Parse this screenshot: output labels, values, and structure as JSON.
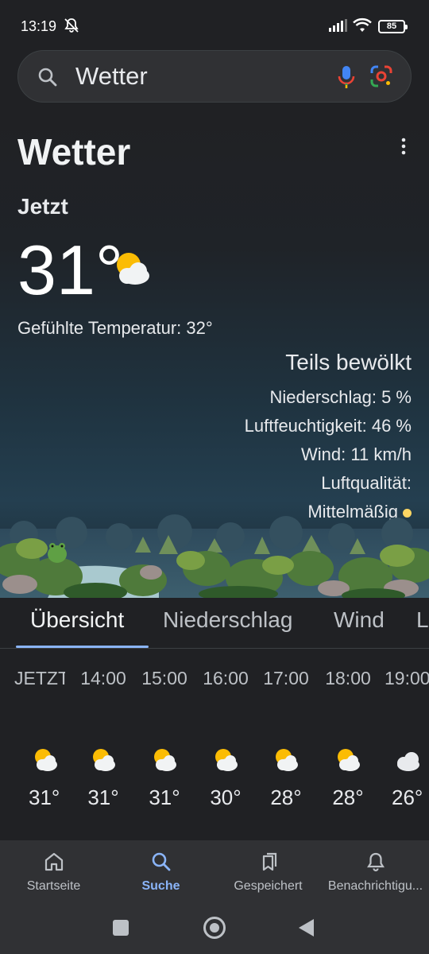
{
  "status": {
    "time": "13:19",
    "battery": "85"
  },
  "search": {
    "query": "Wetter"
  },
  "weather": {
    "title": "Wetter",
    "now_label": "Jetzt",
    "temperature": "31°",
    "feels_like": "Gefühlte Temperatur: 32°",
    "condition": "Teils bewölkt",
    "precipitation": "Niederschlag: 5 %",
    "humidity": "Luftfeuchtigkeit: 46 %",
    "wind": "Wind: 11 km/h",
    "air_quality_label": "Luftqualität:",
    "air_quality_value": "Mittelmäßig",
    "air_quality_color": "#fdd663"
  },
  "tabs": [
    {
      "label": "Übersicht",
      "active": true
    },
    {
      "label": "Niederschlag",
      "active": false
    },
    {
      "label": "Wind",
      "active": false
    },
    {
      "label": "L",
      "active": false
    }
  ],
  "hourly": [
    {
      "time": "JETZT",
      "icon": "partly-cloudy-icon",
      "temp": "31°"
    },
    {
      "time": "14:00",
      "icon": "partly-cloudy-icon",
      "temp": "31°"
    },
    {
      "time": "15:00",
      "icon": "partly-cloudy-icon",
      "temp": "31°"
    },
    {
      "time": "16:00",
      "icon": "partly-cloudy-icon",
      "temp": "30°"
    },
    {
      "time": "17:00",
      "icon": "partly-cloudy-icon",
      "temp": "28°"
    },
    {
      "time": "18:00",
      "icon": "partly-cloudy-icon",
      "temp": "28°"
    },
    {
      "time": "19:00",
      "icon": "cloudy-icon",
      "temp": "26°"
    }
  ],
  "nav": [
    {
      "label": "Startseite",
      "icon": "home-icon",
      "active": false
    },
    {
      "label": "Suche",
      "icon": "search-icon",
      "active": true
    },
    {
      "label": "Gespeichert",
      "icon": "bookmarks-icon",
      "active": false
    },
    {
      "label": "Benachrichtigu...",
      "icon": "bell-icon",
      "active": false
    }
  ],
  "colors": {
    "accent": "#8ab4f8",
    "background": "#202124",
    "sun": "#fbbc04"
  }
}
